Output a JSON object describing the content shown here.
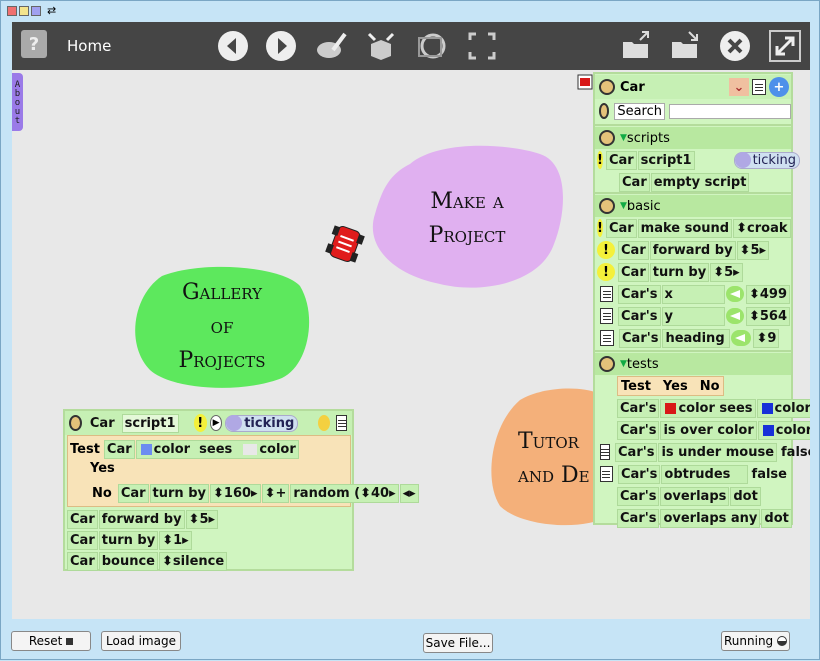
{
  "window": {
    "swatch_colors": [
      "#f07070",
      "#f4e48c",
      "#a0a0f0"
    ],
    "arrows": "⇄"
  },
  "navbar": {
    "home_label": "Home",
    "icons": [
      "help-icon",
      "back-icon",
      "forward-icon",
      "paint-icon",
      "supplies-icon",
      "world-icon",
      "fullscreen-frame-icon",
      "open-project-icon",
      "save-project-icon",
      "close-icon",
      "expand-icon"
    ]
  },
  "about_tab": "About",
  "blobs": {
    "make_project": {
      "line1": "Make a",
      "line2": "Project",
      "color": "#e0b0f0"
    },
    "gallery": {
      "line1": "Gallery",
      "line2": "of",
      "line3": "Projects",
      "color": "#5de85d"
    },
    "tutorials": {
      "line1": "Tutor",
      "line2": "and De",
      "color": "#f4b07a"
    }
  },
  "script_panel": {
    "object": "Car",
    "script_name": "script1",
    "ticking": "ticking",
    "test_label": "Test",
    "test_obj": "Car",
    "test_color_word": "color",
    "test_sees": "sees",
    "test_color2": "color",
    "yes": "Yes",
    "no": "No",
    "no_obj": "Car",
    "turn_by": "turn by",
    "turn_val": "160",
    "plus": "+",
    "random": "random",
    "paren_open": "(",
    "random_val": "40",
    "rows": [
      {
        "obj": "Car",
        "cmd": "forward by",
        "arg": "5"
      },
      {
        "obj": "Car",
        "cmd": "turn by",
        "arg": "1"
      },
      {
        "obj": "Car",
        "cmd": "bounce",
        "arg": "silence"
      }
    ]
  },
  "viewer": {
    "title": "Car",
    "search_label": "Search",
    "search_value": "",
    "scripts": {
      "label": "scripts",
      "r1_obj": "Car",
      "r1_name": "script1",
      "r1_status": "ticking",
      "r2_obj": "Car",
      "r2_cmd": "empty script"
    },
    "basic": {
      "label": "basic",
      "cmds": [
        {
          "obj": "Car",
          "cmd": "make sound",
          "arg": "croak"
        },
        {
          "obj": "Car",
          "cmd": "forward by",
          "arg": "5"
        },
        {
          "obj": "Car",
          "cmd": "turn by",
          "arg": "5"
        }
      ],
      "props": [
        {
          "obj": "Car's",
          "name": "x",
          "val": "499"
        },
        {
          "obj": "Car's",
          "name": "y",
          "val": "564"
        },
        {
          "obj": "Car's",
          "name": "heading",
          "val": "9"
        }
      ]
    },
    "tests": {
      "label": "tests",
      "test": "Test",
      "yes": "Yes",
      "no": "No",
      "rows": [
        {
          "obj": "Car's",
          "a": "color sees",
          "b": "color",
          "c1": "#d81818",
          "c2": "#1830d8"
        },
        {
          "obj": "Car's",
          "a": "is over color",
          "b": "color",
          "c2": "#1830d8"
        },
        {
          "obj": "Car's",
          "a": "is under mouse",
          "b": "false"
        },
        {
          "obj": "Car's",
          "a": "obtrudes",
          "b": "false"
        },
        {
          "obj": "Car's",
          "a": "overlaps",
          "b": "dot"
        },
        {
          "obj": "Car's",
          "a": "overlaps any",
          "b": "dot"
        }
      ]
    }
  },
  "bottom": {
    "reset": "Reset",
    "load_image": "Load image",
    "save_file": "Save File...",
    "running": "Running"
  }
}
